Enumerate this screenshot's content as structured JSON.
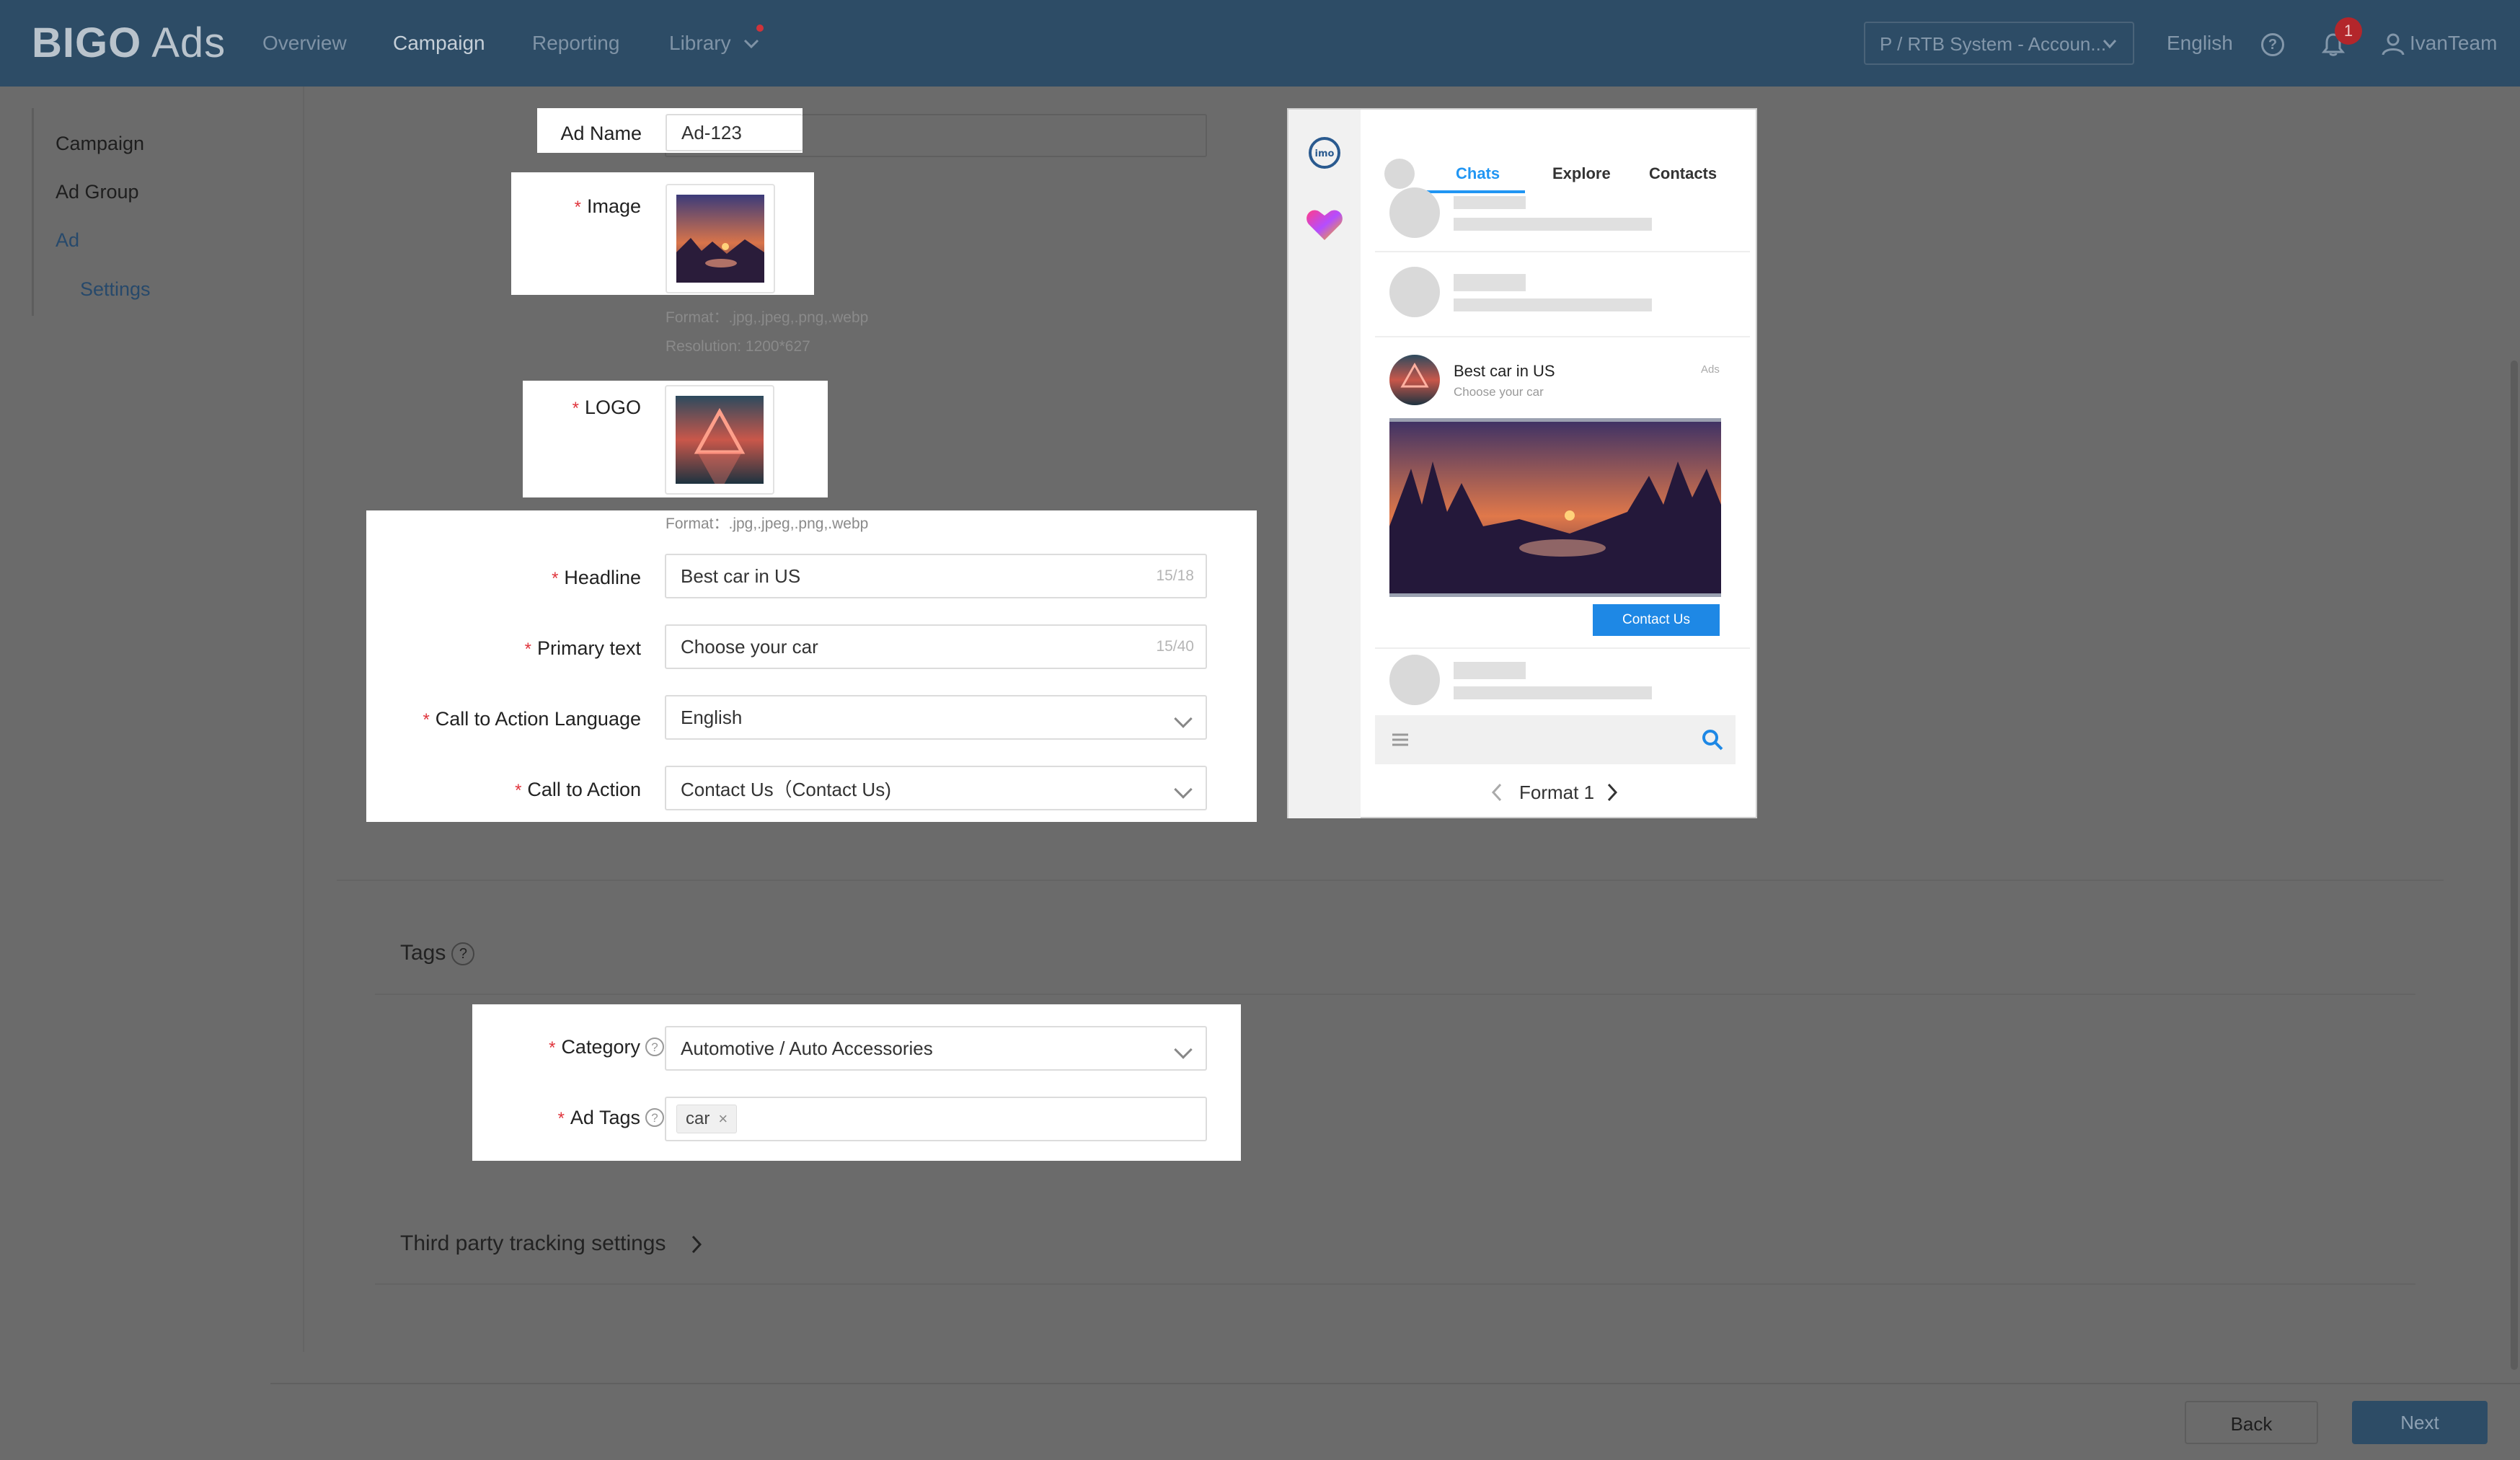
{
  "brand": {
    "name": "BIGO",
    "suffix": "Ads"
  },
  "nav": [
    {
      "label": "Overview"
    },
    {
      "label": "Campaign"
    },
    {
      "label": "Reporting"
    },
    {
      "label": "Library"
    }
  ],
  "header": {
    "account": "P / RTB System - Accoun...",
    "language": "English",
    "notifications": "1",
    "user": "IvanTeam"
  },
  "sidebar": {
    "items": [
      {
        "label": "Campaign"
      },
      {
        "label": "Ad Group"
      },
      {
        "label": "Ad"
      },
      {
        "label": "Settings"
      }
    ]
  },
  "form": {
    "ad_name": {
      "label": "Ad Name",
      "value": "Ad-123"
    },
    "image": {
      "label": "Image",
      "format_hint": "Format：.jpg,.jpeg,.png,.webp",
      "resolution_hint": "Resolution: 1200*627"
    },
    "logo": {
      "label": "LOGO",
      "format_hint": "Format：.jpg,.jpeg,.png,.webp"
    },
    "headline": {
      "label": "Headline",
      "value": "Best car in  US",
      "count": "15/18"
    },
    "primary_text": {
      "label": "Primary text",
      "value": "Choose your car",
      "count": "15/40"
    },
    "cta_language": {
      "label": "Call to Action Language",
      "value": "English"
    },
    "cta": {
      "label": "Call to Action",
      "value": "Contact Us（Contact Us)"
    }
  },
  "preview": {
    "tabs": [
      "Chats",
      "Explore",
      "Contacts"
    ],
    "ad_title": "Best car in US",
    "ad_subtitle": "Choose your car",
    "ad_tag": "Ads",
    "cta_button": "Contact Us",
    "format": "Format 1",
    "app_logo": "imo"
  },
  "tags": {
    "title": "Tags",
    "category": {
      "label": "Category",
      "value": "Automotive / Auto Accessories"
    },
    "ad_tags": {
      "label": "Ad Tags",
      "chip": "car",
      "remove": "×"
    }
  },
  "tracking": {
    "title": "Third party tracking settings"
  },
  "footer": {
    "back": "Back",
    "next": "Next"
  },
  "colors": {
    "topbar": "#2d4c66",
    "accent": "#1e88e5",
    "required": "#e0353d"
  }
}
